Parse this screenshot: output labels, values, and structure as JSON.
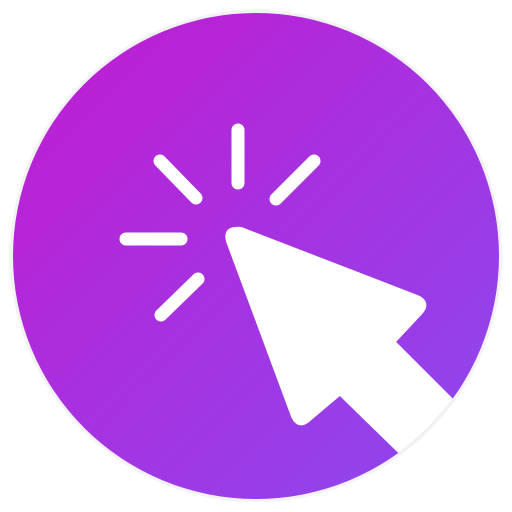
{
  "icon": {
    "name": "click-cursor-icon",
    "description_visible_text": "",
    "colors": {
      "gradient_start": "#c21ad0",
      "gradient_end": "#8a4af0",
      "foreground": "#ffffff",
      "outer_ring": "#f2f2f4"
    }
  }
}
